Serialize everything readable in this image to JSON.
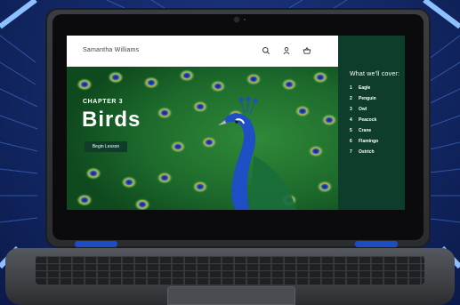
{
  "header": {
    "user_name": "Samantha Williams",
    "icons": [
      "search-icon",
      "user-icon",
      "basket-icon"
    ]
  },
  "hero": {
    "chapter": "CHAPTER 3",
    "title": "Birds",
    "begin_label": "Begin Lesson"
  },
  "sidebar": {
    "title": "What we'll cover:",
    "items": [
      {
        "num": "1",
        "label": "Eagle"
      },
      {
        "num": "2",
        "label": "Penguin"
      },
      {
        "num": "3",
        "label": "Owl"
      },
      {
        "num": "4",
        "label": "Peacock"
      },
      {
        "num": "5",
        "label": "Crane"
      },
      {
        "num": "6",
        "label": "Flamingo"
      },
      {
        "num": "7",
        "label": "Ostrich"
      }
    ]
  },
  "colors": {
    "sidebar_bg": "#0e3d2b",
    "button_bg": "#0f3d2a",
    "backdrop": "#142a6a",
    "hinge_accent": "#1d4cc7"
  }
}
